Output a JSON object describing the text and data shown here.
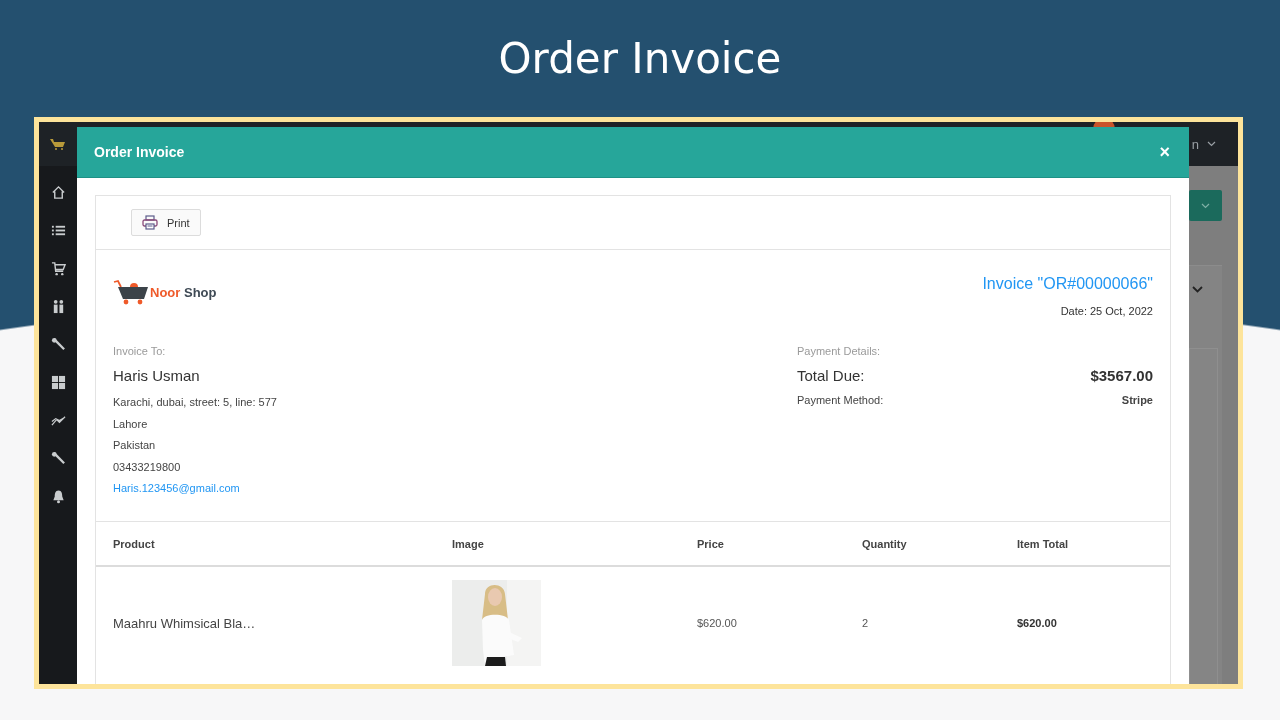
{
  "slide": {
    "title": "Order Invoice"
  },
  "topbar": {
    "user_name": "n"
  },
  "modal": {
    "title": "Order Invoice",
    "close": "×",
    "print_button": "Print",
    "logo_words": [
      "Noor",
      "Shop"
    ],
    "invoice_title": "Invoice \"OR#00000066\"",
    "date": "Date: 25 Oct, 2022",
    "invoice_to": {
      "label": "Invoice To:",
      "name": "Haris Usman",
      "lines": [
        "Karachi, dubai, street: 5, line: 577",
        "Lahore",
        "Pakistan",
        "03433219800"
      ],
      "email": "Haris.123456@gmail.com"
    },
    "payment": {
      "label": "Payment Details:",
      "total_due_label": "Total Due:",
      "total_due": "$3567.00",
      "method_label": "Payment Method:",
      "method": "Stripe"
    },
    "table": {
      "columns": [
        "Product",
        "Image",
        "Price",
        "Quantity",
        "Item Total"
      ],
      "rows": [
        {
          "product": "Maahru Whimsical Bla…",
          "price": "$620.00",
          "quantity": "2",
          "item_total": "$620.00"
        }
      ]
    }
  }
}
